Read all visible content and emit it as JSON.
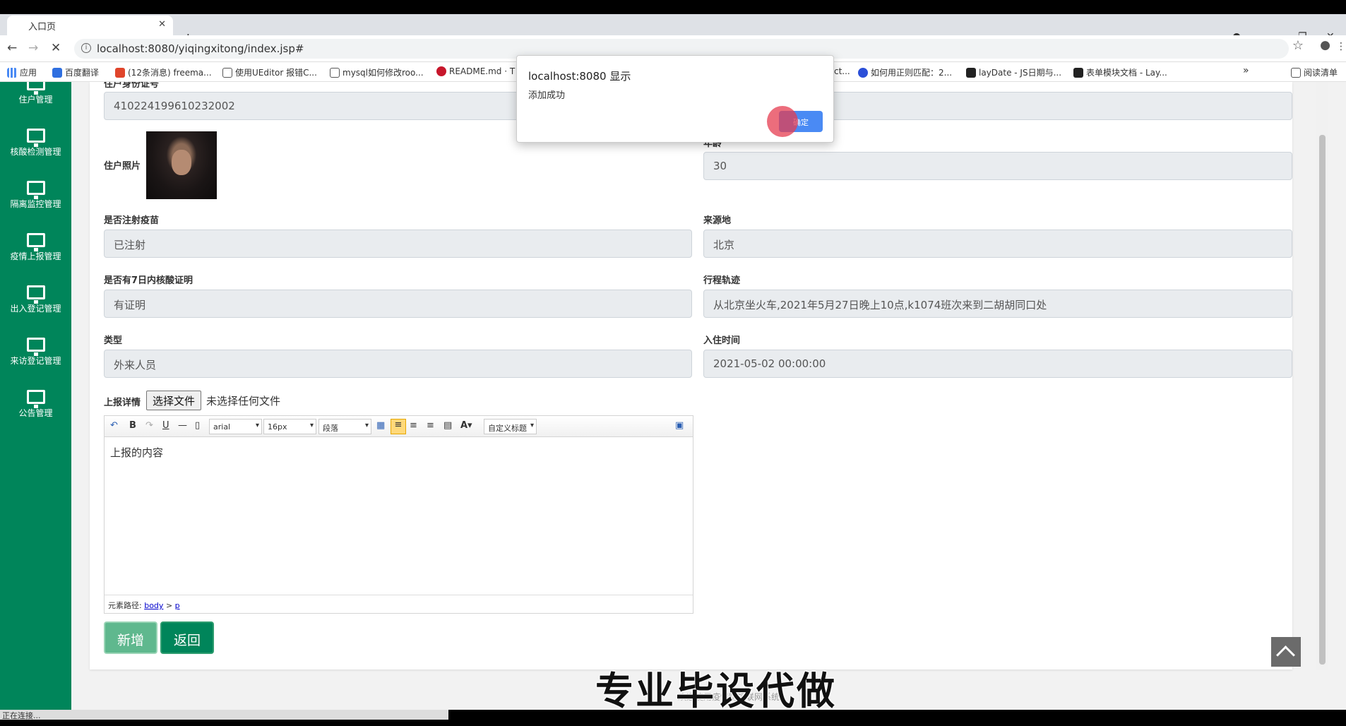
{
  "browser": {
    "tab_title": "入口页",
    "tab_close": "✕",
    "new_tab": "+",
    "url": "localhost:8080/yiqingxitong/index.jsp#",
    "bookmarks": [
      {
        "label": "应用",
        "color": "#4a8af4"
      },
      {
        "label": "百度翻译",
        "color": "#2f6fe0"
      },
      {
        "label": "(12条消息) freema...",
        "color": "#e0452b"
      },
      {
        "label": "使用UEditor 报错C...",
        "color": "#555"
      },
      {
        "label": "mysql如何修改roo...",
        "color": "#555"
      },
      {
        "label": "README.md · T",
        "color": "#c7162b"
      },
      {
        "label": "ct...",
        "color": "#fff"
      },
      {
        "label": "如何用正则匹配：2...",
        "color": "#2b4fd8"
      },
      {
        "label": "layDate - JS日期与...",
        "color": "#222"
      },
      {
        "label": "表单模块文档 - Lay...",
        "color": "#222"
      },
      {
        "label": "»",
        "color": "#fff"
      },
      {
        "label": "阅读清单",
        "color": "#fff"
      }
    ]
  },
  "sidebar": {
    "items": [
      {
        "label": "住户管理"
      },
      {
        "label": "核酸检测管理"
      },
      {
        "label": "隔离监控管理"
      },
      {
        "label": "疫情上报管理"
      },
      {
        "label": "出入登记管理"
      },
      {
        "label": "来访登记管理"
      },
      {
        "label": "公告管理"
      }
    ]
  },
  "form": {
    "id_label": "住户身份证号",
    "id_value": "410224199610232002",
    "right_top_value": "",
    "photo_label": "住户照片",
    "age_label": "年龄",
    "age_value": "30",
    "vaccine_label": "是否注射疫苗",
    "vaccine_value": "已注射",
    "origin_label": "来源地",
    "origin_value": "北京",
    "nucleic_label": "是否有7日内核酸证明",
    "nucleic_value": "有证明",
    "trip_label": "行程轨迹",
    "trip_value": "从北京坐火车,2021年5月27日晚上10点,k1074班次来到二胡胡同口处",
    "type_label": "类型",
    "type_value": "外来人员",
    "checkin_label": "入住时间",
    "checkin_value": "2021-05-02 00:00:00",
    "details_label": "上报详情",
    "file_button": "选择文件",
    "file_status": "未选择任何文件"
  },
  "editor": {
    "font": "arial",
    "size": "16px",
    "paragraph": "段落",
    "custom_title": "自定义标题",
    "content": "上报的内容",
    "path_label": "元素路径:",
    "path_body": "body",
    "path_sep": ">",
    "path_p": "p"
  },
  "buttons": {
    "add": "新增",
    "back": "返回"
  },
  "footer_text": "欢迎使用疫情防控联网系统",
  "watermark": "专业毕设代做",
  "status_text": "正在连接...",
  "dialog": {
    "title": "localhost:8080 显示",
    "message": "添加成功",
    "ok": "确定"
  }
}
